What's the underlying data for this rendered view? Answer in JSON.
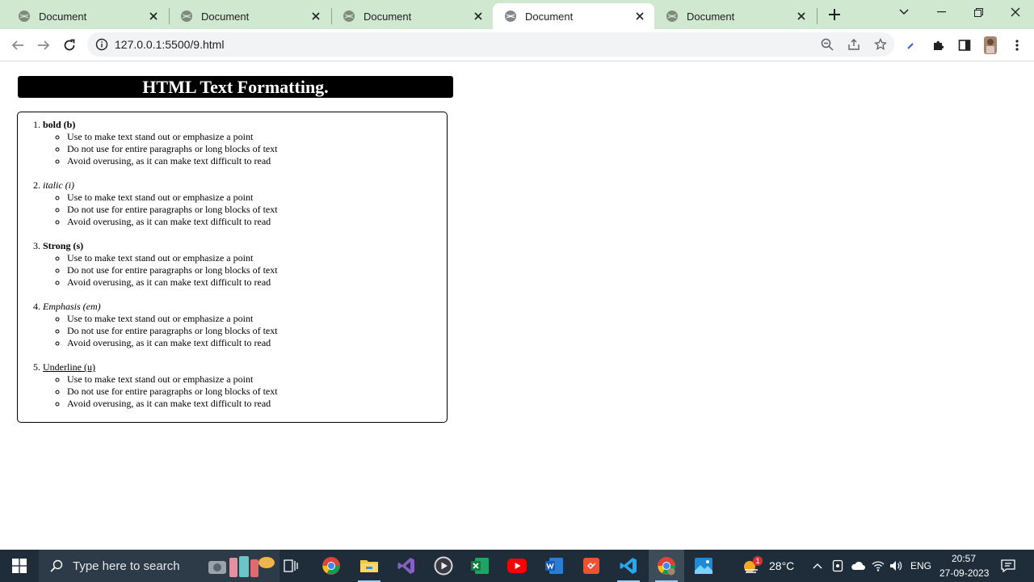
{
  "browser": {
    "tabs": [
      {
        "title": "Document"
      },
      {
        "title": "Document"
      },
      {
        "title": "Document"
      },
      {
        "title": "Document"
      },
      {
        "title": "Document"
      }
    ],
    "active_tab_index": 3,
    "url": "127.0.0.1:5500/9.html"
  },
  "page": {
    "heading": "HTML Text Formatting.",
    "items": [
      {
        "label": "bold (b)",
        "style": "bold",
        "bullets": [
          "Use to make text stand out or emphasize a point",
          "Do not use for entire paragraphs or long blocks of text",
          "Avoid overusing, as it can make text difficult to read"
        ]
      },
      {
        "label": "italic (i)",
        "style": "italic",
        "bullets": [
          "Use to make text stand out or emphasize a point",
          "Do not use for entire paragraphs or long blocks of text",
          "Avoid overusing, as it can make text difficult to read"
        ]
      },
      {
        "label": "Strong (s)",
        "style": "strong",
        "bullets": [
          "Use to make text stand out or emphasize a point",
          "Do not use for entire paragraphs or long blocks of text",
          "Avoid overusing, as it can make text difficult to read"
        ]
      },
      {
        "label": "Emphasis (em)",
        "style": "emphasis",
        "bullets": [
          "Use to make text stand out or emphasize a point",
          "Do not use for entire paragraphs or long blocks of text",
          "Avoid overusing, as it can make text difficult to read"
        ]
      },
      {
        "label": "Underline (u)",
        "style": "underline",
        "bullets": [
          "Use to make text stand out or emphasize a point",
          "Do not use for entire paragraphs or long blocks of text",
          "Avoid overusing, as it can make text difficult to read"
        ]
      }
    ]
  },
  "taskbar": {
    "search_placeholder": "Type here to search",
    "weather_temp": "28°C",
    "weather_badge": "1",
    "language": "ENG",
    "time": "20:57",
    "date": "27-09-2023"
  },
  "colors": {
    "tabstrip": "#cfe8cf",
    "taskbar": "#1f2d3a",
    "heading_bg": "#000000"
  }
}
